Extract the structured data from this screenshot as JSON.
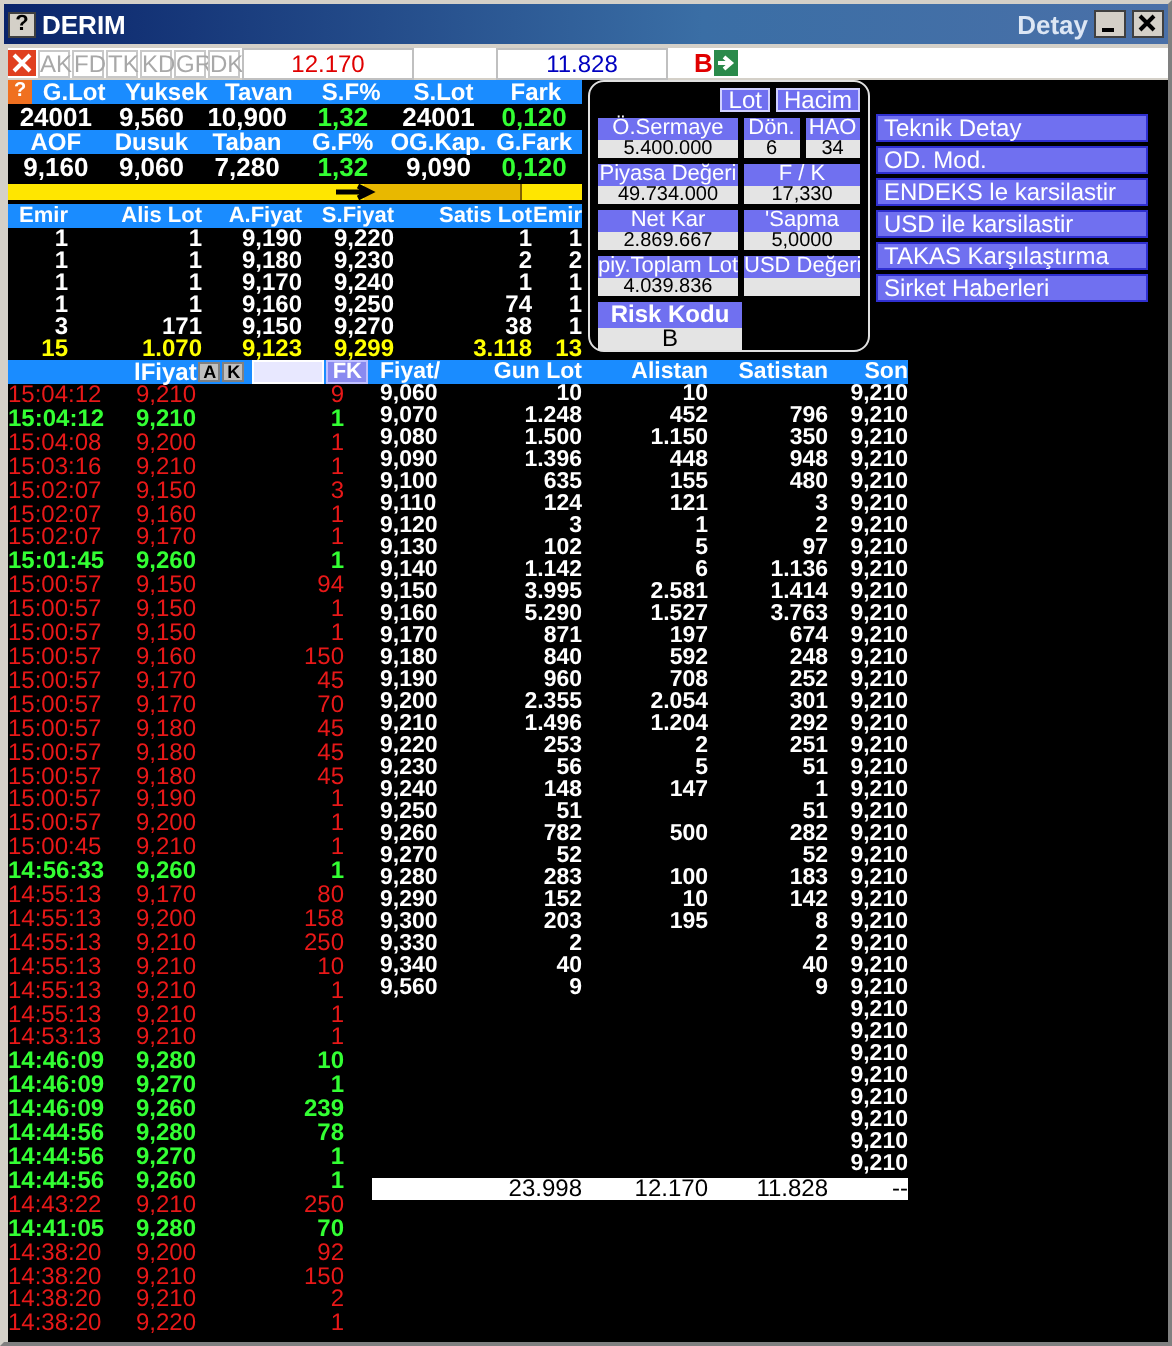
{
  "window": {
    "help": "?",
    "title": "DERIM",
    "subtitle": "Detay"
  },
  "stats_help": "?",
  "toolbar": {
    "toggles": [
      {
        "label": "AK",
        "disabled": true
      },
      {
        "label": "FD",
        "disabled": true
      },
      {
        "label": "TK",
        "disabled": true
      },
      {
        "label": "KD",
        "disabled": true
      },
      {
        "label": "GR",
        "disabled": true
      },
      {
        "label": "DK",
        "disabled": true
      }
    ],
    "bid_total": "12.170",
    "ask_total": "11.828",
    "flag": "B"
  },
  "stats": [
    {
      "headers": [
        "G.Lot",
        "Yuksek",
        "Tavan",
        "S.F%",
        "S.Lot",
        "Fark"
      ],
      "values": [
        {
          "text": "24001",
          "rising": false
        },
        {
          "text": "9,560",
          "rising": false
        },
        {
          "text": "10,900",
          "rising": false
        },
        {
          "text": "1,32",
          "rising": true
        },
        {
          "text": "24001",
          "rising": false
        },
        {
          "text": "0,120",
          "rising": true
        }
      ]
    },
    {
      "headers": [
        "AOF",
        "Dusuk",
        "Taban",
        "G.F%",
        "OG.Kap.",
        "G.Fark"
      ],
      "values": [
        {
          "text": "9,160",
          "rising": false
        },
        {
          "text": "9,060",
          "rising": false
        },
        {
          "text": "7,280",
          "rising": false
        },
        {
          "text": "1,32",
          "rising": true
        },
        {
          "text": "9,090",
          "rising": false
        },
        {
          "text": "0,120",
          "rising": true
        }
      ]
    }
  ],
  "order_book": {
    "columns": [
      "Emir",
      "Alis Lot",
      "A.Fiyat",
      "S.Fiyat",
      "Satis Lot",
      "Emir"
    ],
    "rows": [
      [
        "1",
        "1",
        "9,190",
        "9,220",
        "1",
        "1"
      ],
      [
        "1",
        "1",
        "9,180",
        "9,230",
        "2",
        "2"
      ],
      [
        "1",
        "1",
        "9,170",
        "9,240",
        "1",
        "1"
      ],
      [
        "1",
        "1",
        "9,160",
        "9,250",
        "74",
        "1"
      ],
      [
        "3",
        "171",
        "9,150",
        "9,270",
        "38",
        "1"
      ]
    ],
    "totals": [
      "15",
      "1.070",
      "9,123",
      "9,299",
      "3.118",
      "13"
    ]
  },
  "info": {
    "buttons": [
      "Lot",
      "Hacim"
    ],
    "rows": [
      [
        {
          "label": "Ö.Sermaye",
          "value": "5.400.000"
        },
        {
          "label": "Dön.",
          "value": "6"
        },
        {
          "label": "HAO",
          "value": "34"
        }
      ],
      [
        {
          "label": "Piyasa Değeri",
          "value": "49.734.000"
        },
        {
          "label": "F / K",
          "value": "17,330"
        }
      ],
      [
        {
          "label": "Net Kar",
          "value": "2.869.667"
        },
        {
          "label": "'Sapma",
          "value": "5,0000"
        }
      ],
      [
        {
          "label": "piy.Toplam Lot",
          "value": "4.039.836"
        },
        {
          "label": "USD Değeri"
        }
      ]
    ],
    "risk": {
      "label": "Risk Kodu",
      "value": "B"
    }
  },
  "actions": [
    "Teknik Detay",
    "OD. Mod.",
    "ENDEKS le karsilastir",
    "USD ile karsilastir",
    "TAKAS Karşılaştırma",
    "Sirket Haberleri"
  ],
  "trades": {
    "header": "lFiyat",
    "buttons": [
      "A",
      "K"
    ],
    "filter_button": "FK",
    "rows": [
      {
        "time": "15:04:12",
        "price": "9,210",
        "lot": "9",
        "rising": false
      },
      {
        "time": "15:04:12",
        "price": "9,210",
        "lot": "1",
        "rising": true
      },
      {
        "time": "15:04:08",
        "price": "9,200",
        "lot": "1",
        "rising": false
      },
      {
        "time": "15:03:16",
        "price": "9,210",
        "lot": "1",
        "rising": false
      },
      {
        "time": "15:02:07",
        "price": "9,150",
        "lot": "3",
        "rising": false
      },
      {
        "time": "15:02:07",
        "price": "9,160",
        "lot": "1",
        "rising": false
      },
      {
        "time": "15:02:07",
        "price": "9,170",
        "lot": "1",
        "rising": false
      },
      {
        "time": "15:01:45",
        "price": "9,260",
        "lot": "1",
        "rising": true
      },
      {
        "time": "15:00:57",
        "price": "9,150",
        "lot": "94",
        "rising": false
      },
      {
        "time": "15:00:57",
        "price": "9,150",
        "lot": "1",
        "rising": false
      },
      {
        "time": "15:00:57",
        "price": "9,150",
        "lot": "1",
        "rising": false
      },
      {
        "time": "15:00:57",
        "price": "9,160",
        "lot": "150",
        "rising": false
      },
      {
        "time": "15:00:57",
        "price": "9,170",
        "lot": "45",
        "rising": false
      },
      {
        "time": "15:00:57",
        "price": "9,170",
        "lot": "70",
        "rising": false
      },
      {
        "time": "15:00:57",
        "price": "9,180",
        "lot": "45",
        "rising": false
      },
      {
        "time": "15:00:57",
        "price": "9,180",
        "lot": "45",
        "rising": false
      },
      {
        "time": "15:00:57",
        "price": "9,180",
        "lot": "45",
        "rising": false
      },
      {
        "time": "15:00:57",
        "price": "9,190",
        "lot": "1",
        "rising": false
      },
      {
        "time": "15:00:57",
        "price": "9,200",
        "lot": "1",
        "rising": false
      },
      {
        "time": "15:00:45",
        "price": "9,210",
        "lot": "1",
        "rising": false
      },
      {
        "time": "14:56:33",
        "price": "9,260",
        "lot": "1",
        "rising": true
      },
      {
        "time": "14:55:13",
        "price": "9,170",
        "lot": "80",
        "rising": false
      },
      {
        "time": "14:55:13",
        "price": "9,200",
        "lot": "158",
        "rising": false
      },
      {
        "time": "14:55:13",
        "price": "9,210",
        "lot": "250",
        "rising": false
      },
      {
        "time": "14:55:13",
        "price": "9,210",
        "lot": "10",
        "rising": false
      },
      {
        "time": "14:55:13",
        "price": "9,210",
        "lot": "1",
        "rising": false
      },
      {
        "time": "14:55:13",
        "price": "9,210",
        "lot": "1",
        "rising": false
      },
      {
        "time": "14:53:13",
        "price": "9,210",
        "lot": "1",
        "rising": false
      },
      {
        "time": "14:46:09",
        "price": "9,280",
        "lot": "10",
        "rising": true
      },
      {
        "time": "14:46:09",
        "price": "9,270",
        "lot": "1",
        "rising": true
      },
      {
        "time": "14:46:09",
        "price": "9,260",
        "lot": "239",
        "rising": true
      },
      {
        "time": "14:44:56",
        "price": "9,280",
        "lot": "78",
        "rising": true
      },
      {
        "time": "14:44:56",
        "price": "9,270",
        "lot": "1",
        "rising": true
      },
      {
        "time": "14:44:56",
        "price": "9,260",
        "lot": "1",
        "rising": true
      },
      {
        "time": "14:43:22",
        "price": "9,210",
        "lot": "250",
        "rising": false
      },
      {
        "time": "14:41:05",
        "price": "9,280",
        "lot": "70",
        "rising": true
      },
      {
        "time": "14:38:20",
        "price": "9,200",
        "lot": "92",
        "rising": false
      },
      {
        "time": "14:38:20",
        "price": "9,210",
        "lot": "150",
        "rising": false
      },
      {
        "time": "14:38:20",
        "price": "9,210",
        "lot": "2",
        "rising": false
      },
      {
        "time": "14:38:20",
        "price": "9,220",
        "lot": "1",
        "rising": false
      }
    ]
  },
  "price_table": {
    "columns": [
      "Fiyat/",
      "Gun Lot",
      "Alistan",
      "Satistan",
      "Son"
    ],
    "rows": [
      [
        "9,060",
        "10",
        "10",
        null,
        "9,210"
      ],
      [
        "9,070",
        "1.248",
        "452",
        "796",
        "9,210"
      ],
      [
        "9,080",
        "1.500",
        "1.150",
        "350",
        "9,210"
      ],
      [
        "9,090",
        "1.396",
        "448",
        "948",
        "9,210"
      ],
      [
        "9,100",
        "635",
        "155",
        "480",
        "9,210"
      ],
      [
        "9,110",
        "124",
        "121",
        "3",
        "9,210"
      ],
      [
        "9,120",
        "3",
        "1",
        "2",
        "9,210"
      ],
      [
        "9,130",
        "102",
        "5",
        "97",
        "9,210"
      ],
      [
        "9,140",
        "1.142",
        "6",
        "1.136",
        "9,210"
      ],
      [
        "9,150",
        "3.995",
        "2.581",
        "1.414",
        "9,210"
      ],
      [
        "9,160",
        "5.290",
        "1.527",
        "3.763",
        "9,210"
      ],
      [
        "9,170",
        "871",
        "197",
        "674",
        "9,210"
      ],
      [
        "9,180",
        "840",
        "592",
        "248",
        "9,210"
      ],
      [
        "9,190",
        "960",
        "708",
        "252",
        "9,210"
      ],
      [
        "9,200",
        "2.355",
        "2.054",
        "301",
        "9,210"
      ],
      [
        "9,210",
        "1.496",
        "1.204",
        "292",
        "9,210"
      ],
      [
        "9,220",
        "253",
        "2",
        "251",
        "9,210"
      ],
      [
        "9,230",
        "56",
        "5",
        "51",
        "9,210"
      ],
      [
        "9,240",
        "148",
        "147",
        "1",
        "9,210"
      ],
      [
        "9,250",
        "51",
        null,
        "51",
        "9,210"
      ],
      [
        "9,260",
        "782",
        "500",
        "282",
        "9,210"
      ],
      [
        "9,270",
        "52",
        null,
        "52",
        "9,210"
      ],
      [
        "9,280",
        "283",
        "100",
        "183",
        "9,210"
      ],
      [
        "9,290",
        "152",
        "10",
        "142",
        "9,210"
      ],
      [
        "9,300",
        "203",
        "195",
        "8",
        "9,210"
      ],
      [
        "9,330",
        "2",
        null,
        "2",
        "9,210"
      ],
      [
        "9,340",
        "40",
        null,
        "40",
        "9,210"
      ],
      [
        "9,560",
        "9",
        null,
        "9",
        "9,210"
      ],
      [
        null,
        null,
        null,
        null,
        "9,210"
      ],
      [
        null,
        null,
        null,
        null,
        "9,210"
      ],
      [
        null,
        null,
        null,
        null,
        "9,210"
      ],
      [
        null,
        null,
        null,
        null,
        "9,210"
      ],
      [
        null,
        null,
        null,
        null,
        "9,210"
      ],
      [
        null,
        null,
        null,
        null,
        "9,210"
      ],
      [
        null,
        null,
        null,
        null,
        "9,210"
      ],
      [
        null,
        null,
        null,
        null,
        "9,210"
      ]
    ],
    "totals": [
      "23.998",
      "12.170",
      "11.828",
      "--"
    ]
  }
}
